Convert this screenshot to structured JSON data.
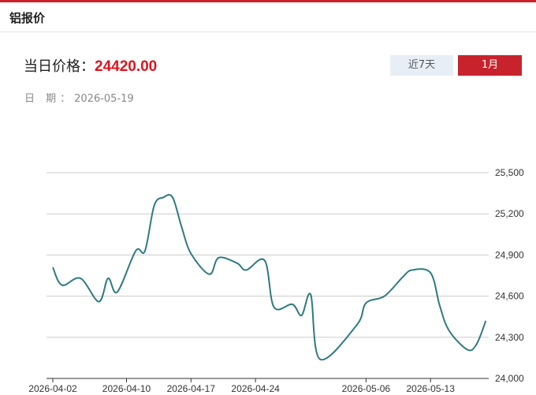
{
  "header": {
    "title": "铝报价"
  },
  "price": {
    "label": "当日价格：",
    "value": "24420.00"
  },
  "date": {
    "label": "日 期：",
    "value": "2026-05-19"
  },
  "range_buttons": {
    "week_label": "近7天",
    "month_label": "1月",
    "active": "1月"
  },
  "colors": {
    "accent": "#c8232c",
    "price": "#e0141e",
    "line": "#2e7b80",
    "grid": "#cccccc"
  },
  "chart_data": {
    "type": "line",
    "x": [
      "2026-04-02",
      "2026-04-03",
      "2026-04-05",
      "2026-04-07",
      "2026-04-08",
      "2026-04-09",
      "2026-04-11",
      "2026-04-12",
      "2026-04-13",
      "2026-04-14",
      "2026-04-15",
      "2026-04-16",
      "2026-04-17",
      "2026-04-19",
      "2026-04-20",
      "2026-04-22",
      "2026-04-23",
      "2026-04-25",
      "2026-04-26",
      "2026-04-28",
      "2026-04-29",
      "2026-04-30",
      "2026-05-01",
      "2026-05-05",
      "2026-05-06",
      "2026-05-08",
      "2026-05-10",
      "2026-05-11",
      "2026-05-13",
      "2026-05-14",
      "2026-05-15",
      "2026-05-17",
      "2026-05-18",
      "2026-05-19"
    ],
    "values": [
      24810,
      24680,
      24730,
      24560,
      24730,
      24630,
      24930,
      24930,
      25260,
      25320,
      25320,
      25100,
      24910,
      24760,
      24880,
      24840,
      24790,
      24860,
      24520,
      24540,
      24460,
      24610,
      24140,
      24390,
      24550,
      24600,
      24740,
      24790,
      24770,
      24530,
      24350,
      24210,
      24250,
      24420
    ],
    "xticks": [
      "2026-04-02",
      "2026-04-10",
      "2026-04-17",
      "2026-04-24",
      "2026-05-06",
      "2026-05-13"
    ],
    "yticks": [
      "25,500",
      "25,200",
      "24,900",
      "24,600",
      "24,300",
      "24,000"
    ],
    "ylim": [
      24000,
      25500
    ],
    "grid": true,
    "legend": "none"
  }
}
